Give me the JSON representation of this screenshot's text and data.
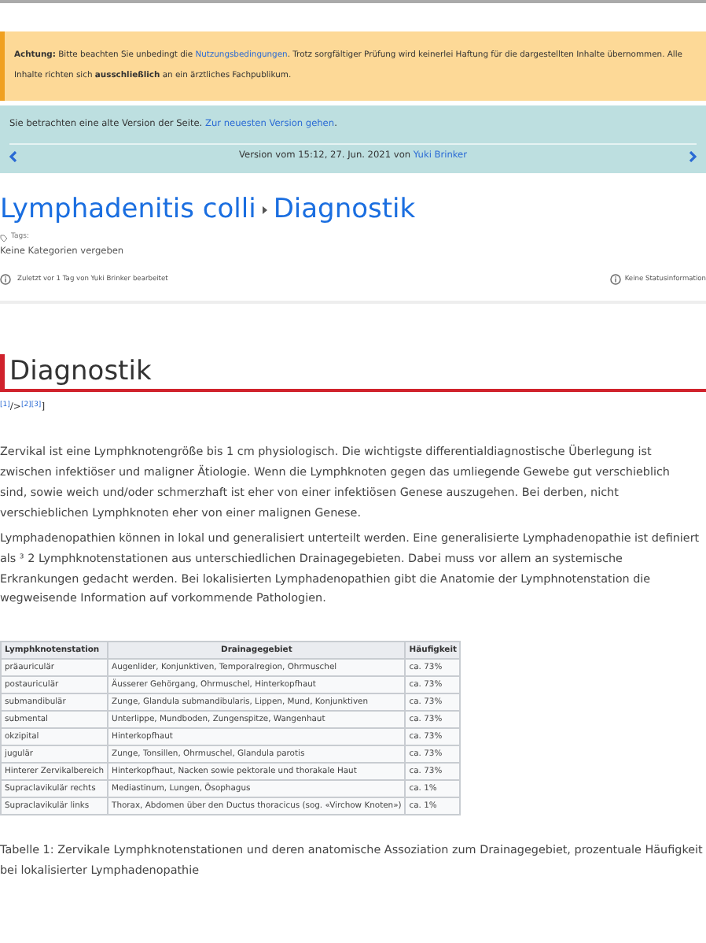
{
  "warning": {
    "label": "Achtung:",
    "before": "Bitte beachten Sie unbedingt die",
    "link": "Nutzungsbedingungen",
    "after": ". Trotz sorgfältiger Prüfung wird keinerlei Haftung für die dargestellten Inhalte übernommen. Alle Inhalte richten sich **ausschließlich** an ein ärztliches Fachpublikum."
  },
  "version_notice": {
    "text": "Sie betrachten eine alte Version der Seite.",
    "link": "Zur neuesten Version gehen",
    "after": ".",
    "version_text": "Version vom 15:12, 27. Jun. 2021 von",
    "author": "Yuki Brinker"
  },
  "breadcrumb": [
    {
      "text": "Lymphadenitis colli"
    },
    {
      "text": "Diagnostik"
    }
  ],
  "tags": {
    "label": "Tags:",
    "value": "Keine Kategorien vergeben"
  },
  "last_edit": "Zuletzt vor 1 Tag von Yuki Brinker bearbeitet",
  "status": "Keine Statusinformation",
  "heading": "Diagnostik",
  "refs": [
    {
      "text": "[1]",
      "kind": "ref"
    },
    {
      "text": "/>",
      "kind": "plain"
    },
    {
      "text": "[2]",
      "kind": "ref"
    },
    {
      "text": "[3]",
      "kind": "ref"
    },
    {
      "text": "]",
      "kind": "plain"
    }
  ],
  "paragraphs": [
    "Zervikal ist eine Lymphknotengröße bis 1 cm physiologisch. Die wichtigste differentialdiagnostische Überlegung ist zwischen infektiöser und maligner Ätiologie.  Wenn die Lymphknoten gegen das umliegende Gewebe gut verschieblich sind, sowie weich und/oder schmerzhaft ist eher von einer infektiösen Genese auszugehen. Bei derben, nicht verschieblichen Lymphknoten eher von einer malignen Genese.",
    "Lymphadenopathien können in lokal und generalisiert unterteilt werden. Eine generalisierte Lymphadenopathie ist definiert als ³ 2 Lymphknotenstationen aus unterschiedlichen Drainagegebieten. Dabei muss vor allem an systemische Erkrankungen gedacht werden. Bei lokalisierten Lymphadenopathien gibt die Anatomie der Lymphnotenstation die wegweisende Information auf vorkommende Pathologien."
  ],
  "table": {
    "columns": [
      "Lymphknotenstation",
      "Drainagegebiet",
      "Häufigkeit"
    ],
    "rows": [
      [
        "präauriculär",
        "Augenlider, Konjunktiven, Temporalregion, Ohrmuschel",
        "ca. 73%"
      ],
      [
        "postauriculär",
        "Äusserer Gehörgang, Ohrmuschel, Hinterkopfhaut",
        "ca. 73%"
      ],
      [
        "submandibulär",
        "Zunge, Glandula submandibularis, Lippen, Mund, Konjunktiven",
        "ca. 73%"
      ],
      [
        "submental",
        "Unterlippe, Mundboden, Zungenspitze, Wangenhaut",
        "ca. 73%"
      ],
      [
        "okzipital",
        "Hinterkopfhaut",
        "ca. 73%"
      ],
      [
        "jugulär",
        "Zunge, Tonsillen, Ohrmuschel, Glandula parotis",
        "ca. 73%"
      ],
      [
        "Hinterer Zervikalbereich",
        "Hinterkopfhaut, Nacken sowie pektorale und thorakale Haut",
        "ca. 73%"
      ],
      [
        "Supraclavikulär rechts",
        "Mediastinum, Lungen, Ösophagus",
        "ca. 1%"
      ],
      [
        "Supraclavikulär links",
        "Thorax, Abdomen über den Ductus thoracicus (sog. «Virchow Knoten»)",
        "ca. 1%"
      ]
    ]
  },
  "caption": "Tabelle 1: Zervikale Lymphknotenstationen und deren anatomische Assoziation zum Drainagegebiet, prozentuale Häufigkeit bei lokalisierter Lymphadenopathie"
}
